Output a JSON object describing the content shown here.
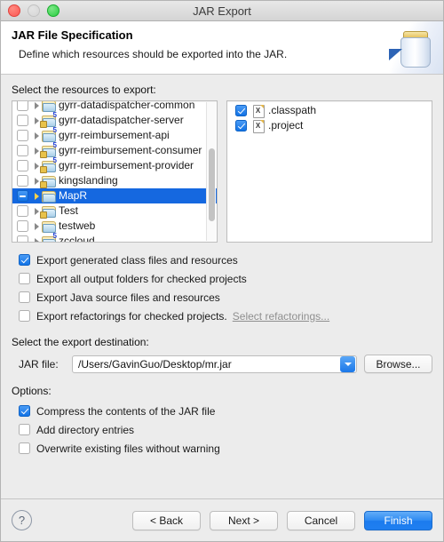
{
  "window": {
    "title": "JAR Export",
    "traffic_lights": [
      "close",
      "minimize",
      "zoom"
    ]
  },
  "header": {
    "title": "JAR File Specification",
    "subtitle": "Define which resources should be exported into the JAR.",
    "icon": "jar-icon"
  },
  "resources": {
    "label": "Select the resources to export:",
    "tree": [
      {
        "name": "gyrr-datadispatcher-common",
        "checked": "off",
        "badge": "",
        "lock": false
      },
      {
        "name": "gyrr-datadispatcher-server",
        "checked": "off",
        "badge": "5",
        "lock": true
      },
      {
        "name": "gyrr-reimbursement-api",
        "checked": "off",
        "badge": "5",
        "lock": false
      },
      {
        "name": "gyrr-reimbursement-consumer",
        "checked": "off",
        "badge": "5",
        "lock": true
      },
      {
        "name": "gyrr-reimbursement-provider",
        "checked": "off",
        "badge": "5",
        "lock": true
      },
      {
        "name": "kingslanding",
        "checked": "off",
        "badge": "",
        "lock": true
      },
      {
        "name": "MapR",
        "checked": "partial",
        "badge": "",
        "lock": false,
        "selected": true
      },
      {
        "name": "Test",
        "checked": "off",
        "badge": "",
        "lock": true
      },
      {
        "name": "testweb",
        "checked": "off",
        "badge": "",
        "lock": false
      },
      {
        "name": "zccloud",
        "checked": "off",
        "badge": "5",
        "lock": true
      }
    ],
    "files": [
      {
        "name": ".classpath",
        "checked": "on",
        "icon": "xml-file-icon"
      },
      {
        "name": ".project",
        "checked": "on",
        "icon": "xml-file-icon"
      }
    ]
  },
  "export_options": [
    {
      "label": "Export generated class files and resources",
      "checked": "on"
    },
    {
      "label": "Export all output folders for checked projects",
      "checked": "off"
    },
    {
      "label": "Export Java source files and resources",
      "checked": "off"
    },
    {
      "label": "Export refactorings for checked projects.",
      "checked": "off",
      "link": "Select refactorings..."
    }
  ],
  "destination": {
    "label": "Select the export destination:",
    "field_label": "JAR file:",
    "value": "/Users/GavinGuo/Desktop/mr.jar",
    "placeholder": "",
    "browse_label": "Browse..."
  },
  "options": {
    "label": "Options:",
    "items": [
      {
        "label": "Compress the contents of the JAR file",
        "checked": "on"
      },
      {
        "label": "Add directory entries",
        "checked": "off"
      },
      {
        "label": "Overwrite existing files without warning",
        "checked": "off"
      }
    ]
  },
  "footer": {
    "help_label": "?",
    "back_label": "< Back",
    "next_label": "Next >",
    "cancel_label": "Cancel",
    "finish_label": "Finish"
  },
  "colors": {
    "accent_blue": "#1568e0",
    "primary_button": "#2f8bf2",
    "window_bg": "#ececec",
    "selection": "#1568e0"
  }
}
